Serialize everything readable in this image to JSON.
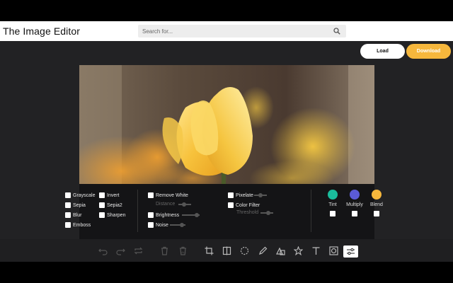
{
  "app": {
    "title": "The Image Editor"
  },
  "search": {
    "placeholder": "Search for..."
  },
  "actions": {
    "load_label": "Load",
    "download_label": "Download"
  },
  "filters": {
    "col1": [
      "Grayscale",
      "Sepia",
      "Blur",
      "Emboss"
    ],
    "col2": [
      "Invert",
      "Sepia2",
      "Sharpen"
    ],
    "remove_white": "Remove White",
    "distance": "Distance",
    "brightness": "Brightness",
    "noise": "Noise",
    "pixelate": "Pixelate",
    "color_filter": "Color Filter",
    "threshold": "Threshold"
  },
  "blend": {
    "tint": {
      "label": "Tint",
      "color": "#1abc9c"
    },
    "multiply": {
      "label": "Multiply",
      "color": "#5b5bd6"
    },
    "blend": {
      "label": "Blend",
      "color": "#f6b73c"
    }
  },
  "colors": {
    "accent": "#f6b73c",
    "workspace": "#222224",
    "toolbar": "#1f1f21"
  },
  "toolbar_icons": [
    "undo-icon",
    "redo-icon",
    "repeat-icon",
    "delete-icon",
    "delete-all-icon",
    "crop-icon",
    "flip-icon",
    "rotate-icon",
    "draw-icon",
    "shape-icon",
    "star-icon",
    "text-icon",
    "mask-icon",
    "filter-icon"
  ]
}
